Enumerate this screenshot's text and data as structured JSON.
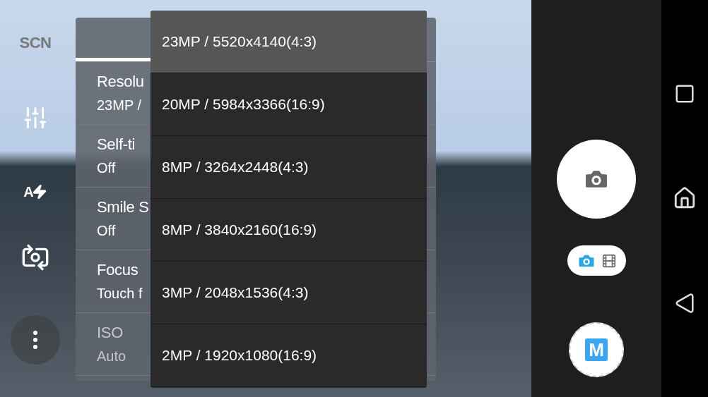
{
  "left_bar": {
    "scene_label": "SCN",
    "flash_label": "A"
  },
  "settings_panel": {
    "tabs": [
      {
        "selected": true
      },
      {
        "selected": false
      }
    ],
    "items": [
      {
        "label": "Resolu",
        "value": "23MP /",
        "disabled": false
      },
      {
        "label": "Self-ti",
        "value": "Off",
        "disabled": false
      },
      {
        "label": "Smile S",
        "value": "Off",
        "disabled": false
      },
      {
        "label": "Focus",
        "value": "Touch f",
        "disabled": false
      },
      {
        "label": "ISO",
        "value": "Auto",
        "disabled": true
      }
    ]
  },
  "resolution_menu": [
    {
      "label": "23MP / 5520x4140(4:3)",
      "selected": true
    },
    {
      "label": "20MP / 5984x3366(16:9)",
      "selected": false
    },
    {
      "label": "8MP / 3264x2448(4:3)",
      "selected": false
    },
    {
      "label": "8MP / 3840x2160(16:9)",
      "selected": false
    },
    {
      "label": "3MP / 2048x1536(4:3)",
      "selected": false
    },
    {
      "label": "2MP / 1920x1080(16:9)",
      "selected": false
    }
  ],
  "mode_toggle": [
    {
      "kind": "photo",
      "selected": true
    },
    {
      "kind": "video",
      "selected": false
    }
  ],
  "manual_mode_label": "M"
}
